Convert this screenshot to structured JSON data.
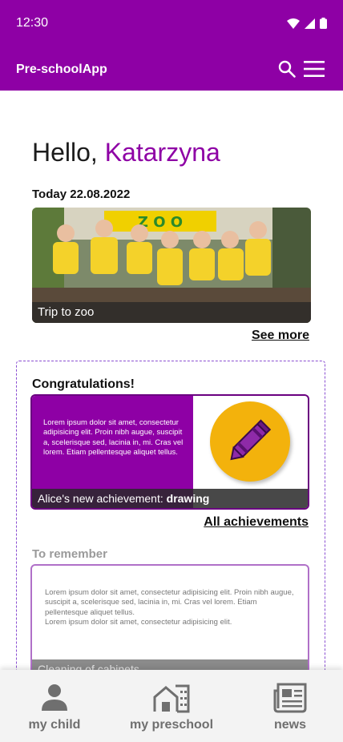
{
  "status_bar": {
    "time": "12:30"
  },
  "app_bar": {
    "title": "Pre-schoolApp"
  },
  "greeting": {
    "hello": "Hello,",
    "name": "Katarzyna"
  },
  "today": {
    "label": "Today 22.08.2022"
  },
  "hero": {
    "caption": "Trip to zoo",
    "sign_text": "Z O O"
  },
  "see_more": "See more",
  "achievement": {
    "heading": "Congratulations!",
    "lorem": "Lorem ipsum dolor sit amet, consectetur adipisicing elit. Proin nibh augue, suscipit a, scelerisque sed, lacinia in, mi. Cras vel lorem. Etiam pellentesque aliquet tellus.",
    "footer_prefix": "Alice's new achievement:",
    "footer_value": "drawing"
  },
  "all_achievements": "All achievements",
  "remember": {
    "heading": "To remember",
    "text": "Lorem ipsum dolor sit amet, consectetur adipisicing elit. Proin nibh augue, suscipit a, scelerisque sed, lacinia in, mi. Cras vel lorem. Etiam pellentesque aliquet tellus.\nLorem ipsum dolor sit amet, consectetur adipisicing elit.",
    "footer": "Cleaning of cabinets"
  },
  "bottom_nav": [
    {
      "label": "my child",
      "icon": "person-icon"
    },
    {
      "label": "my preschool",
      "icon": "building-icon"
    },
    {
      "label": "news",
      "icon": "newspaper-icon"
    }
  ],
  "colors": {
    "primary": "#8e00a5",
    "accent_yellow": "#f3b20c",
    "nav_gray": "#6f6f6f"
  }
}
